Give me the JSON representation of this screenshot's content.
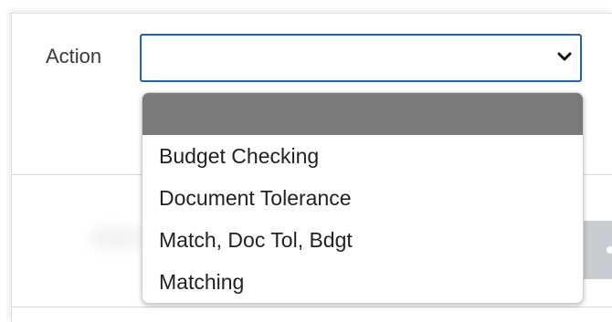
{
  "form": {
    "action_label": "Action",
    "action_select": {
      "value": "",
      "icon": "chevron-down-icon"
    }
  },
  "dropdown": {
    "options": [
      {
        "label": "",
        "highlighted": true
      },
      {
        "label": "Budget Checking",
        "highlighted": false
      },
      {
        "label": "Document Tolerance",
        "highlighted": false
      },
      {
        "label": "Match, Doc Tol, Bdgt",
        "highlighted": false
      },
      {
        "label": "Matching",
        "highlighted": false
      }
    ]
  },
  "colors": {
    "focus_border": "#1c5fc2",
    "highlight": "#7a7a7a",
    "text": "#222222"
  }
}
